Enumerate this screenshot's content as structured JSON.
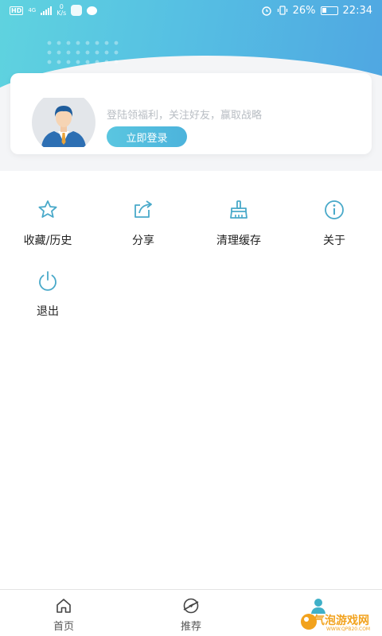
{
  "status_bar": {
    "network_type": "HD",
    "net_gen": "4G",
    "speed_value": "0",
    "speed_unit": "K/s",
    "battery": "26%",
    "time": "22:34"
  },
  "login_card": {
    "hint": "登陆领福利，关注好友，赢取战略",
    "login_button": "立即登录"
  },
  "menu": [
    {
      "label": "收藏/历史",
      "icon": "star-icon"
    },
    {
      "label": "分享",
      "icon": "share-icon"
    },
    {
      "label": "清理缓存",
      "icon": "broom-icon"
    },
    {
      "label": "关于",
      "icon": "info-icon"
    },
    {
      "label": "退出",
      "icon": "power-icon"
    }
  ],
  "bottom_nav": [
    {
      "label": "首页",
      "icon": "home-icon",
      "active": false
    },
    {
      "label": "推荐",
      "icon": "compass-icon",
      "active": false
    },
    {
      "label": "",
      "icon": "user-icon",
      "active": true
    }
  ],
  "watermark": {
    "text": "气泡游戏网",
    "sub": "WWW.QPB20.COM"
  },
  "colors": {
    "accent": "#4fb3d9",
    "gradient_start": "#5fd3df",
    "gradient_end": "#4fa6e2",
    "icon": "#49a9c9"
  }
}
